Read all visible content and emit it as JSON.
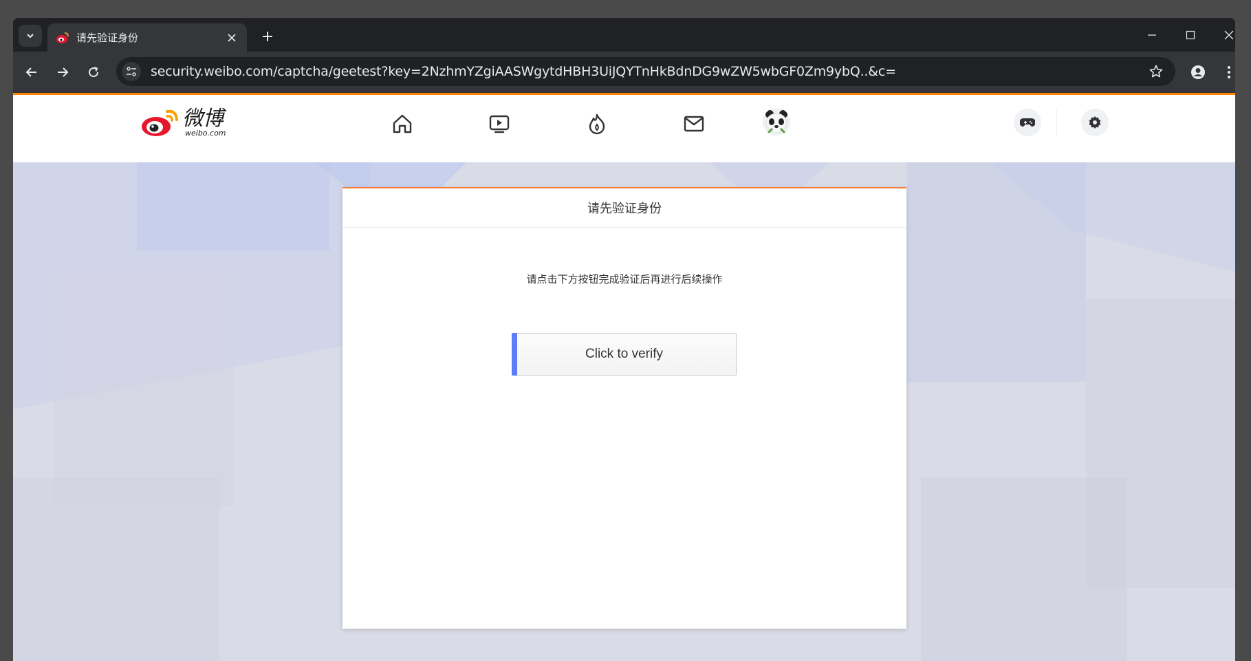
{
  "browser": {
    "tab": {
      "title": "请先验证身份"
    },
    "url": "security.weibo.com/captcha/geetest?key=2NzhmYZgiAASWgytdHBH3UiJQYTnHkBdnDG9wZW5wbGF0Zm9ybQ..&c="
  },
  "site": {
    "logo_cn": "微博",
    "logo_en": "weibo.com",
    "nav_icons": [
      "home-icon",
      "video-icon",
      "hot-icon",
      "message-icon"
    ],
    "brand_color": "#ff8200"
  },
  "dialog": {
    "title": "请先验证身份",
    "hint": "请点击下方按钮完成验证后再进行后续操作",
    "verify_label": "Click to verify",
    "accent_color": "#5b7df7"
  }
}
